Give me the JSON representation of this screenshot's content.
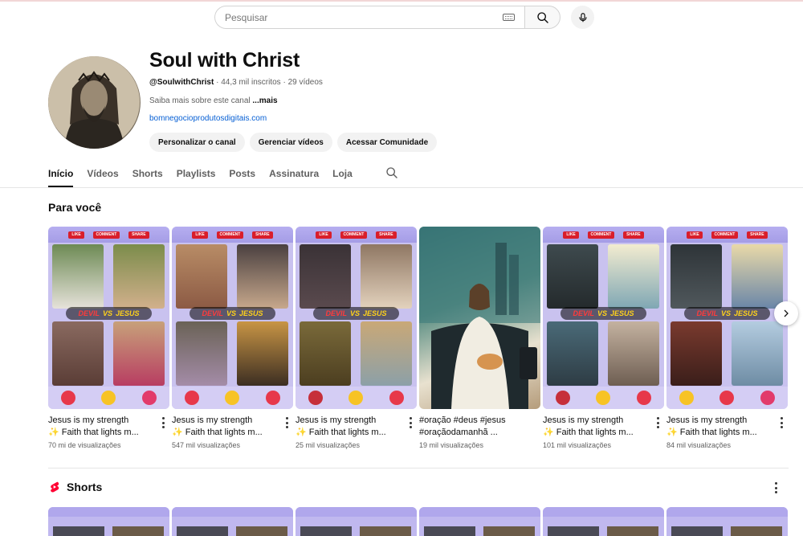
{
  "search": {
    "placeholder": "Pesquisar"
  },
  "channel": {
    "name": "Soul with Christ",
    "handle": "@SoulwithChrist",
    "subscribers": "44,3 mil inscritos",
    "video_count": "29 vídeos",
    "about": "Saiba mais sobre este canal",
    "about_more": "...mais",
    "link": "bomnegocioprodutosdigitais.com",
    "buttons": [
      "Personalizar o canal",
      "Gerenciar vídeos",
      "Acessar Comunidade"
    ]
  },
  "tabs": [
    "Início",
    "Vídeos",
    "Shorts",
    "Playlists",
    "Posts",
    "Assinatura",
    "Loja"
  ],
  "active_tab": "Início",
  "for_you": {
    "title": "Para você",
    "videos": [
      {
        "title_line1": "Jesus is my strength",
        "title_line2": "✨ Faith that lights m...",
        "views": "70 mi de visualizações"
      },
      {
        "title_line1": "Jesus is my strength",
        "title_line2": "✨ Faith that lights m...",
        "views": "547 mil visualizações"
      },
      {
        "title_line1": "Jesus is my strength",
        "title_line2": "✨ Faith that lights m...",
        "views": "25 mil visualizações"
      },
      {
        "title_line1": "#oração #deus #jesus",
        "title_line2": "#oraçãodamanhã ...",
        "views": "19 mil visualizações"
      },
      {
        "title_line1": "Jesus is my strength",
        "title_line2": "✨ Faith that lights m...",
        "views": "101 mil visualizações"
      },
      {
        "title_line1": "Jesus is my strength",
        "title_line2": "✨ Faith that lights m...",
        "views": "84 mil visualizações"
      }
    ],
    "thumb_text": {
      "devil": "DEVIL",
      "vs": "VS",
      "jesus": "JESUS",
      "like": "LIKE",
      "comment": "COMMENT",
      "share": "SHARE"
    }
  },
  "shorts": {
    "title": "Shorts"
  },
  "colors": {
    "accent": "#0f0f0f",
    "link": "#065fd4",
    "shorts_red": "#ff0033",
    "chip_bg": "#f2f2f2"
  }
}
